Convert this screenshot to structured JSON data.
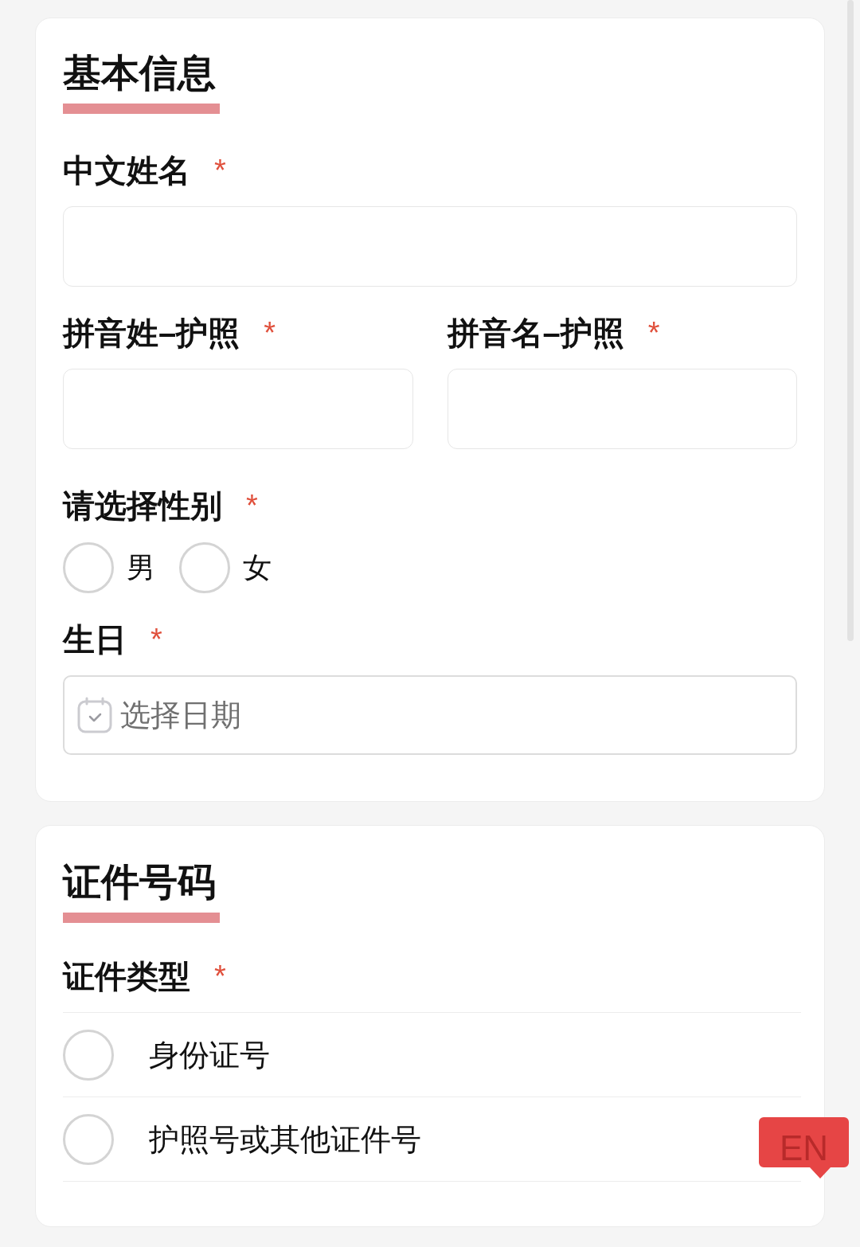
{
  "sections": [
    {
      "title": "基本信息",
      "fields": [
        {
          "kind": "text",
          "label": "中文姓名",
          "mark": "*"
        },
        {
          "kind": "text_pair",
          "items": [
            {
              "label": "拼音姓–护照",
              "mark": "*"
            },
            {
              "label": "拼音名–护照",
              "mark": "*"
            }
          ]
        },
        {
          "kind": "radio_inline",
          "label": "请选择性别",
          "mark": "*",
          "options": [
            {
              "label": "男",
              "selected": false
            },
            {
              "label": "女",
              "selected": false
            }
          ]
        },
        {
          "kind": "date",
          "label": "生日",
          "mark": "*",
          "placeholder": "选择日期"
        }
      ]
    },
    {
      "title": "证件号码",
      "fields": [
        {
          "kind": "radio_list",
          "label": "证件类型",
          "mark": "*",
          "options": [
            {
              "label": "身份证号",
              "selected": false
            },
            {
              "label": "护照号或其他证件号",
              "selected": false
            }
          ]
        }
      ]
    }
  ],
  "language_button": {
    "label": "EN"
  }
}
